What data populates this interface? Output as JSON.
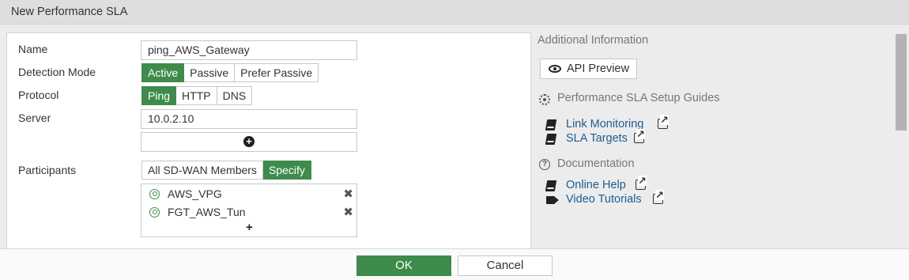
{
  "window": {
    "title": "New Performance SLA"
  },
  "form": {
    "name_label": "Name",
    "name_value": "ping_AWS_Gateway",
    "detection_label": "Detection Mode",
    "detection_options": [
      "Active",
      "Passive",
      "Prefer Passive"
    ],
    "detection_selected": "Active",
    "protocol_label": "Protocol",
    "protocol_options": [
      "Ping",
      "HTTP",
      "DNS"
    ],
    "protocol_selected": "Ping",
    "server_label": "Server",
    "server_value": "10.0.2.10",
    "participants_label": "Participants",
    "participants_options": [
      "All SD-WAN Members",
      "Specify"
    ],
    "participants_selected": "Specify",
    "members": [
      {
        "name": "AWS_VPG"
      },
      {
        "name": "FGT_AWS_Tun"
      }
    ]
  },
  "side": {
    "additional_info": "Additional Information",
    "api_preview": "API Preview",
    "setup_guides_header": "Performance SLA Setup Guides",
    "guides": [
      {
        "label": "Link Monitoring",
        "icon": "book-icon"
      },
      {
        "label": "SLA Targets",
        "icon": "book-icon"
      }
    ],
    "documentation_header": "Documentation",
    "docs": [
      {
        "label": "Online Help",
        "icon": "book-icon"
      },
      {
        "label": "Video Tutorials",
        "icon": "video-icon"
      }
    ]
  },
  "footer": {
    "ok": "OK",
    "cancel": "Cancel"
  },
  "colors": {
    "accent": "#3e8b4b",
    "link": "#1f5b8f"
  }
}
